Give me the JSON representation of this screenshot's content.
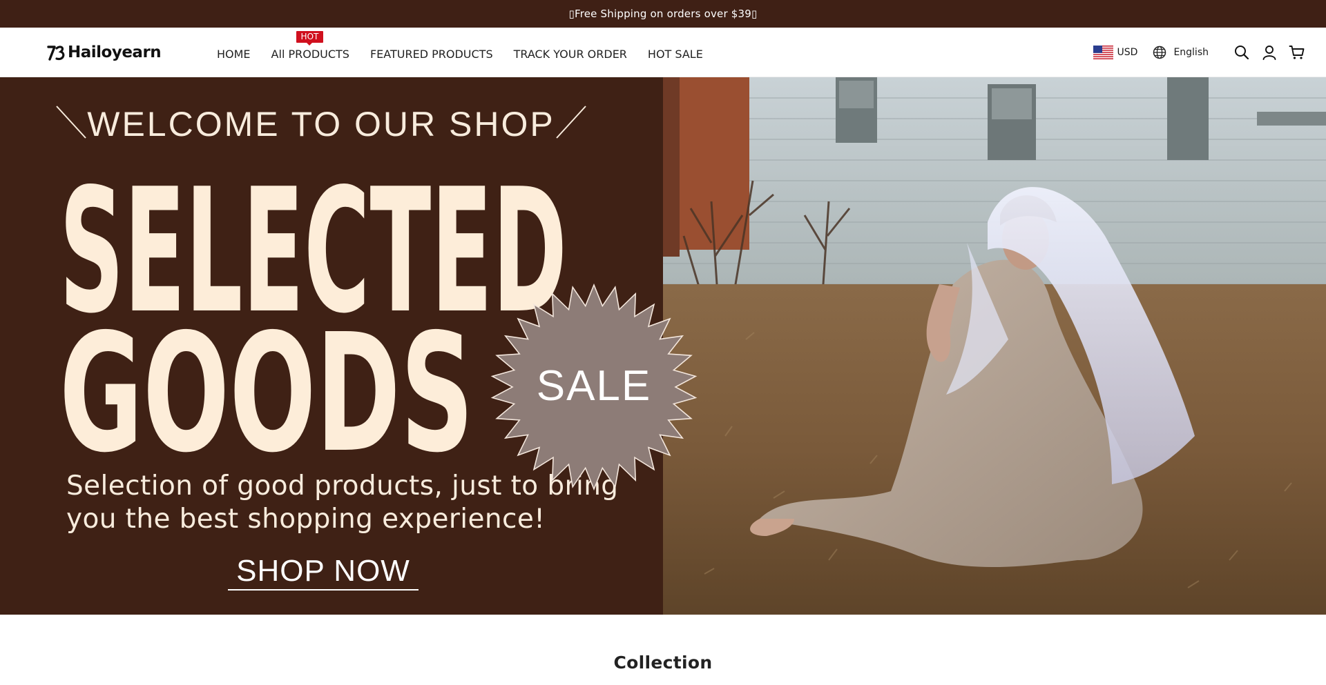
{
  "announcement": {
    "text": "▯Free Shipping on orders over $39▯"
  },
  "header": {
    "logo_text": "Hailoyearn",
    "nav": [
      {
        "label": "HOME",
        "badge": ""
      },
      {
        "label": "All PRODUCTS",
        "badge": "HOT"
      },
      {
        "label": "FEATURED PRODUCTS",
        "badge": ""
      },
      {
        "label": "TRACK YOUR ORDER",
        "badge": ""
      },
      {
        "label": "HOT SALE",
        "badge": ""
      }
    ],
    "currency": "USD",
    "currency_flag_icon": "us-flag-icon",
    "language": "English",
    "icons": [
      "globe-icon",
      "search-icon",
      "account-icon",
      "cart-icon"
    ]
  },
  "hero": {
    "welcome": "WELCOME TO OUR SHOP",
    "headline_line1": "SELECTED",
    "headline_line2": "GOODS",
    "subtitle_line1": "Selection of good products, just to bring",
    "subtitle_line2": "you the best shopping experience!",
    "cta": "SHOP NOW",
    "badge": "SALE",
    "colors": {
      "panel_bg": "#3f2115",
      "headline": "#fdedd9",
      "badge_fill": "#8d7c77"
    }
  },
  "collection": {
    "title": "Collection"
  },
  "colors": {
    "announcement_bg": "#3f2015",
    "hot_badge": "#d0101e"
  }
}
